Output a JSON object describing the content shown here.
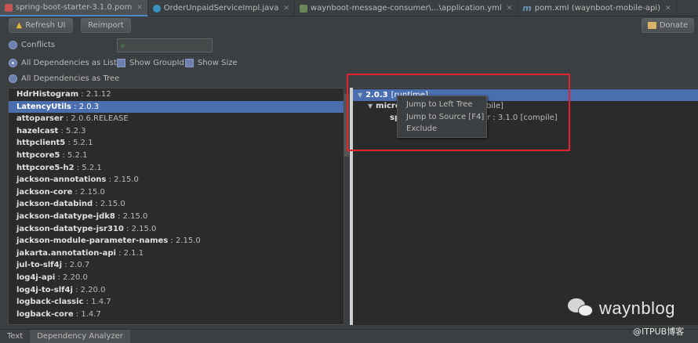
{
  "tabs": [
    {
      "label": "spring-boot-starter-3.1.0.pom",
      "icon": "maven-file-icon",
      "active": true
    },
    {
      "label": "OrderUnpaidServiceImpl.java",
      "icon": "java-class-icon"
    },
    {
      "label": "waynboot-message-consumer\\...\\application.yml",
      "icon": "yaml-file-icon"
    },
    {
      "label": "pom.xml (waynboot-mobile-api)",
      "icon": "maven-m-icon"
    }
  ],
  "toolbar": {
    "refresh_label": "Refresh UI",
    "reimport_label": "Reimport",
    "donate_label": "Donate"
  },
  "options": {
    "conflicts_label": "Conflicts",
    "list_label": "All Dependencies as List",
    "tree_label": "All Dependencies as Tree",
    "show_groupid_label": "Show GroupId",
    "show_size_label": "Show Size",
    "search_value": ""
  },
  "dependencies": [
    {
      "name": "HdrHistogram",
      "version": " : 2.1.12"
    },
    {
      "name": "LatencyUtils",
      "version": " : 2.0.3",
      "selected": true
    },
    {
      "name": "attoparser",
      "version": " : 2.0.6.RELEASE"
    },
    {
      "name": "hazelcast",
      "version": " : 5.2.3"
    },
    {
      "name": "httpclient5",
      "version": " : 5.2.1"
    },
    {
      "name": "httpcore5",
      "version": " : 5.2.1"
    },
    {
      "name": "httpcore5-h2",
      "version": " : 5.2.1"
    },
    {
      "name": "jackson-annotations",
      "version": " : 2.15.0"
    },
    {
      "name": "jackson-core",
      "version": " : 2.15.0"
    },
    {
      "name": "jackson-databind",
      "version": " : 2.15.0"
    },
    {
      "name": "jackson-datatype-jdk8",
      "version": " : 2.15.0"
    },
    {
      "name": "jackson-datatype-jsr310",
      "version": " : 2.15.0"
    },
    {
      "name": "jackson-module-parameter-names",
      "version": " : 2.15.0"
    },
    {
      "name": "jakarta.annotation-api",
      "version": " : 2.1.1"
    },
    {
      "name": "jul-to-slf4j",
      "version": " : 2.0.7"
    },
    {
      "name": "log4j-api",
      "version": " : 2.20.0"
    },
    {
      "name": "log4j-to-slf4j",
      "version": " : 2.20.0"
    },
    {
      "name": "logback-classic",
      "version": " : 1.4.7"
    },
    {
      "name": "logback-core",
      "version": " : 1.4.7"
    }
  ],
  "tree": {
    "root_version": "2.0.3",
    "root_scope": " [runtime]",
    "child1_name": "micro",
    "child1_suffix": "bile]",
    "child2_name": "sp",
    "child2_suffix": "r : 3.1.0 [compile]"
  },
  "context_menu": [
    "Jump to Left Tree",
    "Jump to Source [F4]",
    "Exclude"
  ],
  "bottom_tabs": {
    "text": "Text",
    "analyzer": "Dependency Analyzer"
  },
  "watermark": {
    "brand": "waynblog",
    "site": "@ITPUB博客"
  }
}
